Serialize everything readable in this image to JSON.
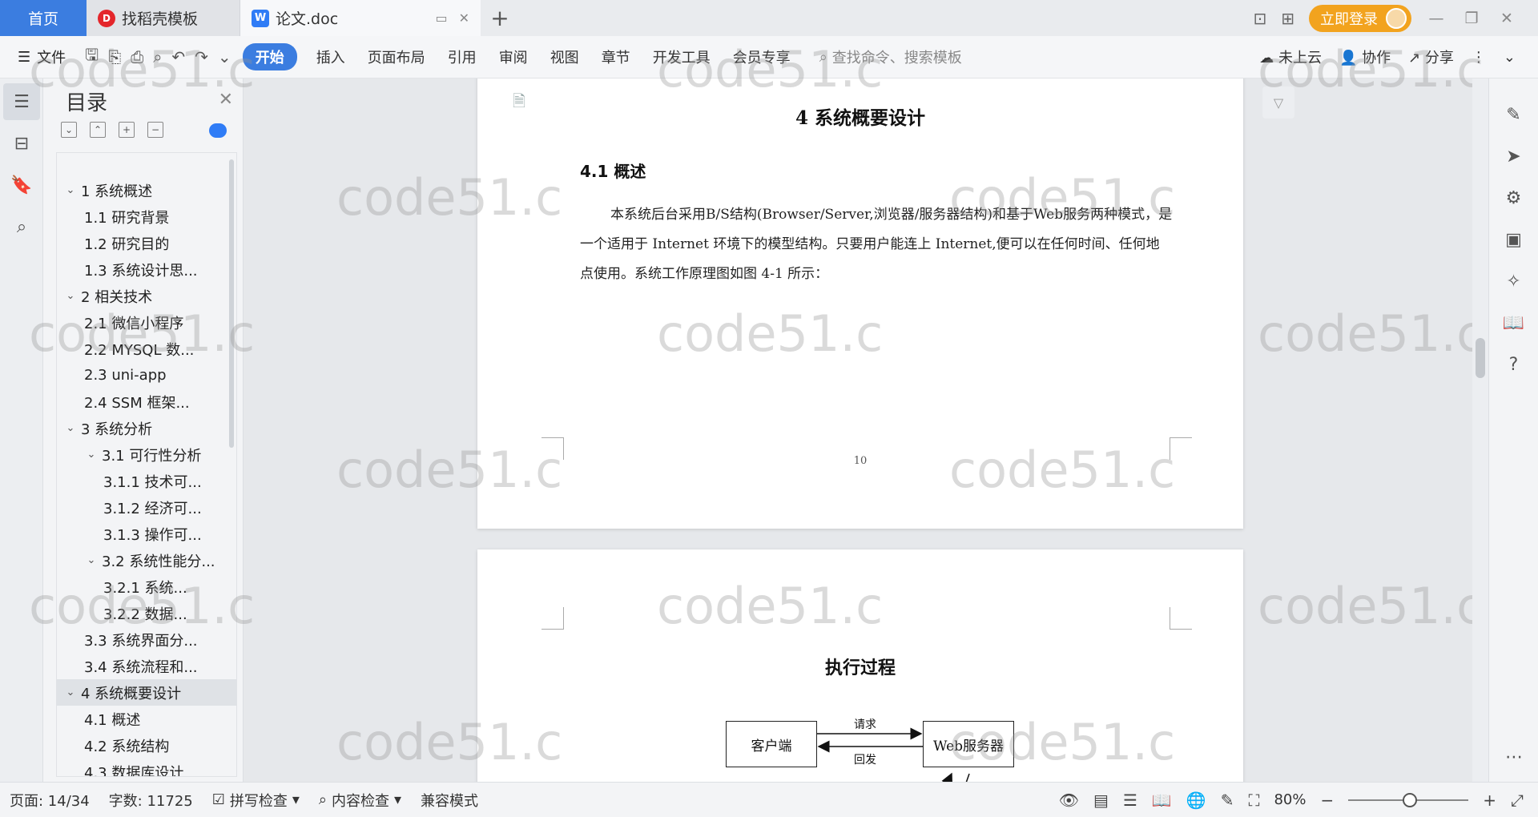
{
  "tabs": {
    "home": "首页",
    "templates": "找稻壳模板",
    "document": "论文.doc"
  },
  "topbar": {
    "login": "立即登录"
  },
  "ribbon": {
    "file": "文件",
    "menus": [
      "开始",
      "插入",
      "页面布局",
      "引用",
      "审阅",
      "视图",
      "章节",
      "开发工具",
      "会员专享"
    ],
    "search_placeholder": "查找命令、搜索模板",
    "cloud": "未上云",
    "collab": "协作",
    "share": "分享"
  },
  "toc": {
    "title": "目录",
    "items": [
      {
        "label": "1 系统概述",
        "level": 1
      },
      {
        "label": "1.1  研究背景",
        "level": 2
      },
      {
        "label": "1.2 研究目的",
        "level": 2
      },
      {
        "label": "1.3 系统设计思...",
        "level": 2
      },
      {
        "label": "2 相关技术",
        "level": 1
      },
      {
        "label": "2.1 微信小程序",
        "level": 2
      },
      {
        "label": "2.2 MYSQL 数...",
        "level": 2
      },
      {
        "label": "2.3 uni-app",
        "level": 2
      },
      {
        "label": "2.4 SSM 框架...",
        "level": 2
      },
      {
        "label": "3 系统分析",
        "level": 1
      },
      {
        "label": "3.1 可行性分析",
        "level": 3
      },
      {
        "label": "3.1.1 技术可...",
        "level": 4
      },
      {
        "label": "3.1.2 经济可...",
        "level": 4
      },
      {
        "label": "3.1.3 操作可...",
        "level": 4
      },
      {
        "label": "3.2 系统性能分...",
        "level": 3
      },
      {
        "label": "3.2.1  系统...",
        "level": 4
      },
      {
        "label": "3.2.2  数据...",
        "level": 4
      },
      {
        "label": "3.3 系统界面分...",
        "level": 2
      },
      {
        "label": "3.4 系统流程和...",
        "level": 2
      },
      {
        "label": "4 系统概要设计",
        "level": 1,
        "selected": true
      },
      {
        "label": "4.1 概述",
        "level": 2
      },
      {
        "label": "4.2 系统结构",
        "level": 2
      },
      {
        "label": "4.3 数据库设计",
        "level": 2
      }
    ]
  },
  "page1": {
    "title": "4 系统概要设计",
    "heading": "4.1 概述",
    "body": "本系统后台采用B/S结构(Browser/Server,浏览器/服务器结构)和基于Web服务两种模式，是一个适用于 Internet 环境下的模型结构。只要用户能连上 Internet,便可以在任何时间、任何地点使用。系统工作原理图如图 4-1 所示：",
    "page_number": "10"
  },
  "page2": {
    "title": "执行过程",
    "client": "客户端",
    "server": "Web服务器",
    "request": "请求",
    "reply": "回发"
  },
  "watermark": "code51.c",
  "statusbar": {
    "page": "页面: 14/34",
    "words": "字数: 11725",
    "spellcheck": "拼写检查",
    "content_check": "内容检查",
    "compat": "兼容模式",
    "zoom": "80%"
  }
}
